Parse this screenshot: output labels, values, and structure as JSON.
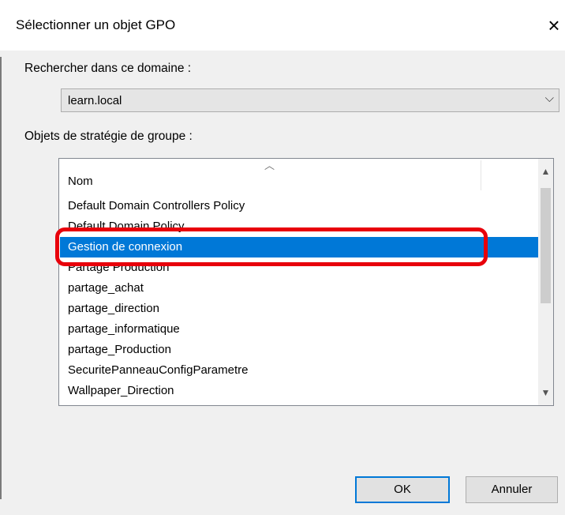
{
  "window": {
    "title": "Sélectionner un objet GPO",
    "close_glyph": "×"
  },
  "domain_section": {
    "label": "Rechercher dans ce domaine :",
    "selected": "learn.local",
    "chevron": "⌵"
  },
  "gpo_section": {
    "label": "Objets de stratégie de groupe :"
  },
  "list": {
    "column_header": "Nom",
    "sort_glyph": "︿",
    "scroll_up_glyph": "▲",
    "scroll_down_glyph": "▼",
    "selected_index": 2,
    "items": [
      "Default Domain Controllers Policy",
      "Default Domain Policy",
      "Gestion de connexion",
      "Partage Production",
      "partage_achat",
      "partage_direction",
      "partage_informatique",
      "partage_Production",
      "SecuritePanneauConfigParametre",
      "Wallpaper_Direction"
    ]
  },
  "buttons": {
    "ok": "OK",
    "cancel": "Annuler"
  },
  "colors": {
    "selection": "#0078d7",
    "highlight_box": "#e8000b"
  }
}
